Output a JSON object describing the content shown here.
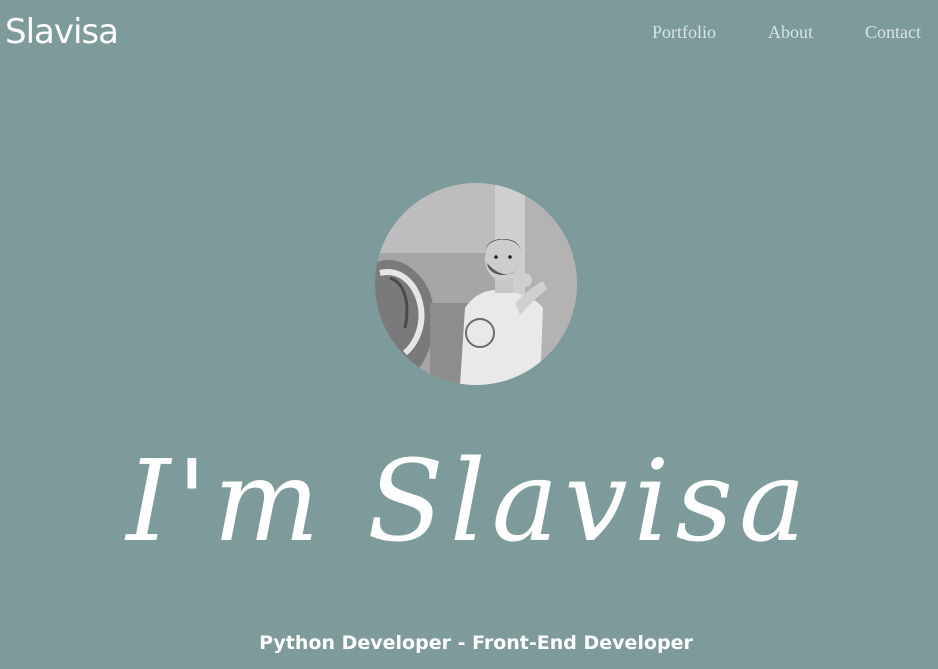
{
  "navbar": {
    "brand": "Slavisa",
    "links": [
      {
        "label": "Portfolio"
      },
      {
        "label": "About"
      },
      {
        "label": "Contact"
      }
    ]
  },
  "hero": {
    "avatar_icon": "profile-photo",
    "headline": "I'm Slavisa",
    "subtitle": "Python Developer - Front-End Developer"
  },
  "colors": {
    "background": "#7c9b9a",
    "text": "#ffffff",
    "nav_link": "#d9e3e2"
  }
}
